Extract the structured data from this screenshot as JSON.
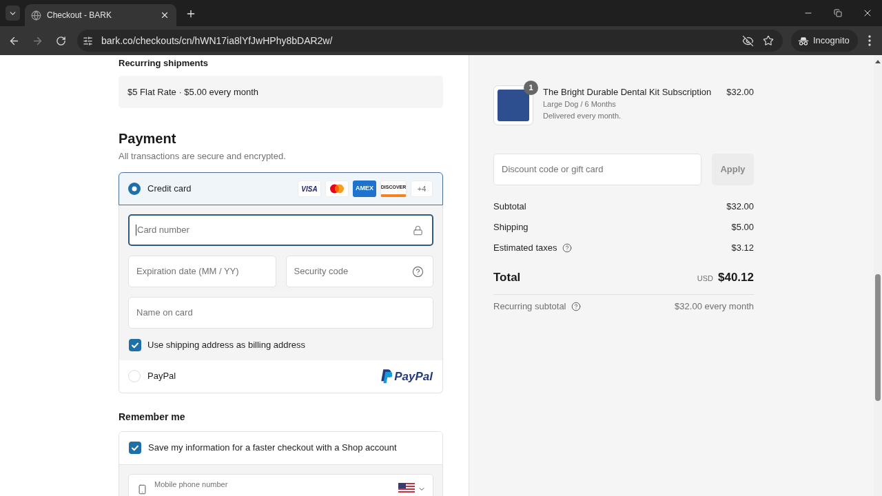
{
  "browser": {
    "tab": {
      "title": "Checkout - BARK"
    },
    "address_bar": {
      "url": "bark.co/checkouts/cn/hWN17ia8lYfJwHPhy8bDAR2w/"
    },
    "profile_button": {
      "label": "Incognito"
    }
  },
  "recurring_shipments": {
    "title": "Recurring shipments",
    "rate": "$5 Flat Rate · $5.00 every month"
  },
  "payment": {
    "title": "Payment",
    "subtitle": "All transactions are secure and encrypted.",
    "methods": [
      {
        "kind": "card",
        "label": "Credit card",
        "selected": true,
        "brands": [
          {
            "kind": "visa",
            "text": "VISA"
          },
          {
            "kind": "mastercard"
          },
          {
            "kind": "amex",
            "text": "AMEX"
          },
          {
            "kind": "discover",
            "text": "DISCOVER"
          }
        ],
        "more_brands": "+4",
        "fields": [
          {
            "kind": "card_number",
            "placeholder": "Card number",
            "focused": true
          },
          {
            "kind": "expiry",
            "placeholder": "Expiration date (MM / YY)",
            "focused": false
          },
          {
            "kind": "security_code",
            "placeholder": "Security code",
            "focused": false
          },
          {
            "kind": "name",
            "placeholder": "Name on card",
            "focused": false
          }
        ],
        "billing_checkbox": {
          "label": "Use shipping address as billing address",
          "checked": true
        }
      },
      {
        "kind": "paypal",
        "label": "PayPal",
        "selected": false,
        "logo_text": "PayPal"
      }
    ]
  },
  "remember_me": {
    "title": "Remember me",
    "save_checkbox": {
      "label": "Save my information for a faster checkout with a Shop account",
      "checked": true
    },
    "phone_field": {
      "label": "Mobile phone number"
    }
  },
  "order_summary": {
    "items": [
      {
        "title": "The Bright Durable Dental Kit Subscription",
        "quantity": "1",
        "variant": "Large Dog / 6 Months",
        "delivery": "Delivered every month.",
        "price": "$32.00"
      }
    ],
    "discount": {
      "placeholder": "Discount code or gift card",
      "button": "Apply",
      "disabled": true
    },
    "lines": [
      {
        "label": "Subtotal",
        "value": "$32.00",
        "help": false
      },
      {
        "label": "Shipping",
        "value": "$5.00",
        "help": false
      },
      {
        "label": "Estimated taxes",
        "value": "$3.12",
        "help": true
      }
    ],
    "total": {
      "label": "Total",
      "currency": "USD",
      "value": "$40.12"
    },
    "recurring": {
      "label": "Recurring subtotal",
      "value": "$32.00 every month",
      "help": true
    }
  }
}
